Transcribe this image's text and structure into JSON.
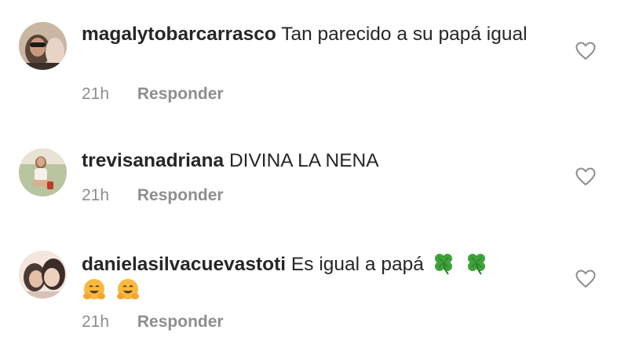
{
  "comments": [
    {
      "username": "magalytobarcarrasco",
      "text": "Tan parecido a su papá igual",
      "time": "21h",
      "reply_label": "Responder",
      "avatar_colors": [
        "#c9b7a3",
        "#3a2f2a",
        "#e8d4c4"
      ]
    },
    {
      "username": "trevisanadriana",
      "text": "DIVINA LA NENA",
      "time": "21h",
      "reply_label": "Responder",
      "avatar_colors": [
        "#b9c4a0",
        "#9a6f4c",
        "#e9e2d5"
      ]
    },
    {
      "username": "danielasilvacuevastoti",
      "text": "Es igual a papá",
      "emojis": [
        "four-leaf-clover",
        "four-leaf-clover",
        "hugging-face",
        "hugging-face"
      ],
      "time": "21h",
      "reply_label": "Responder",
      "avatar_colors": [
        "#d8c2b5",
        "#4a3a36",
        "#f3e6de"
      ]
    }
  ],
  "colors": {
    "text": "#262626",
    "muted": "#8e8e8e",
    "heart_stroke": "#8e8e8e",
    "clover": "#3ea33a",
    "hug_face": "#f7b93e"
  }
}
